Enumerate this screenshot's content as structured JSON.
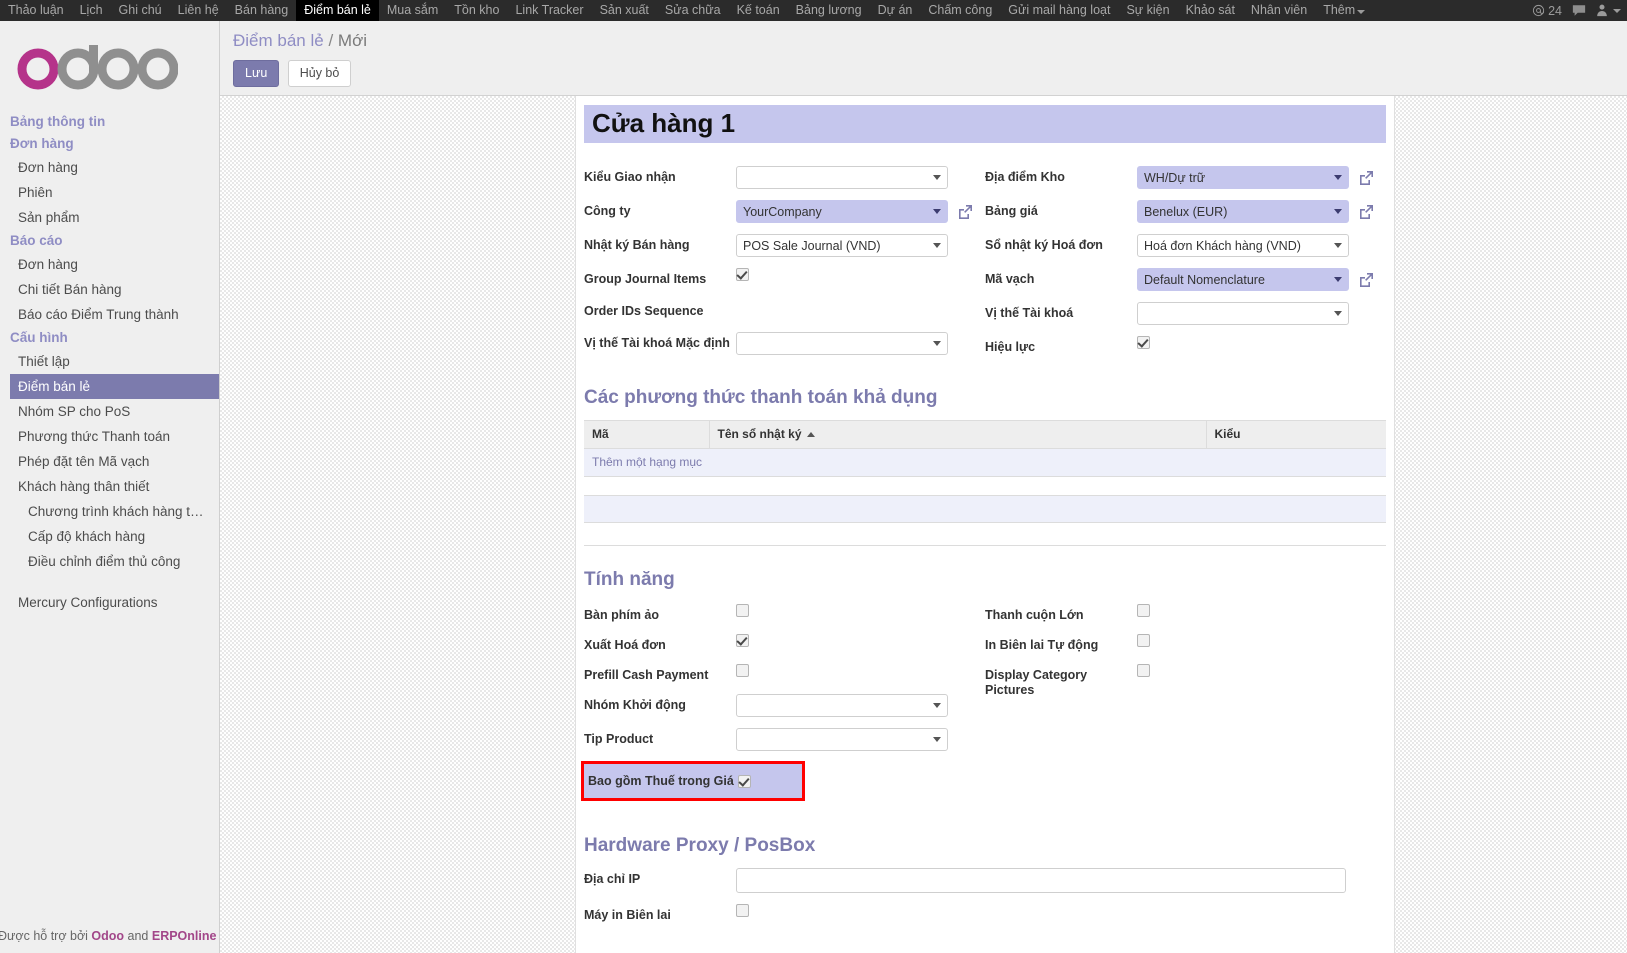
{
  "navbar": {
    "items": [
      {
        "label": "Thảo luận",
        "active": false
      },
      {
        "label": "Lịch",
        "active": false
      },
      {
        "label": "Ghi chú",
        "active": false
      },
      {
        "label": "Liên hệ",
        "active": false
      },
      {
        "label": "Bán hàng",
        "active": false
      },
      {
        "label": "Điểm bán lẻ",
        "active": true
      },
      {
        "label": "Mua sắm",
        "active": false
      },
      {
        "label": "Tồn kho",
        "active": false
      },
      {
        "label": "Link Tracker",
        "active": false
      },
      {
        "label": "Sản xuất",
        "active": false
      },
      {
        "label": "Sửa chữa",
        "active": false
      },
      {
        "label": "Kế toán",
        "active": false
      },
      {
        "label": "Bảng lương",
        "active": false
      },
      {
        "label": "Dự án",
        "active": false
      },
      {
        "label": "Chấm công",
        "active": false
      },
      {
        "label": "Gửi mail hàng loạt",
        "active": false
      },
      {
        "label": "Sự kiện",
        "active": false
      },
      {
        "label": "Khảo sát",
        "active": false
      },
      {
        "label": "Nhân viên",
        "active": false
      },
      {
        "label": "Thêm",
        "active": false,
        "caret": true
      }
    ],
    "mention_count": "24",
    "mention_icon": "at-sign-icon",
    "messages_icon": "chat-bubble-icon",
    "user_icon": "user-menu-icon"
  },
  "sidebar": {
    "logo_text": "odoo",
    "groups": [
      {
        "type": "section",
        "label": "Bảng thông tin"
      },
      {
        "type": "section",
        "label": "Đơn hàng"
      },
      {
        "type": "item",
        "label": "Đơn hàng"
      },
      {
        "type": "item",
        "label": "Phiên"
      },
      {
        "type": "item",
        "label": "Sản phẩm"
      },
      {
        "type": "section",
        "label": "Báo cáo"
      },
      {
        "type": "item",
        "label": "Đơn hàng"
      },
      {
        "type": "item",
        "label": "Chi tiết Bán hàng"
      },
      {
        "type": "item",
        "label": "Báo cáo Điểm Trung thành"
      },
      {
        "type": "section",
        "label": "Cấu hình"
      },
      {
        "type": "item",
        "label": "Thiết lập"
      },
      {
        "type": "item",
        "label": "Điểm bán lẻ",
        "selected": true
      },
      {
        "type": "item",
        "label": "Nhóm SP cho PoS"
      },
      {
        "type": "item",
        "label": "Phương thức Thanh toán"
      },
      {
        "type": "item",
        "label": "Phép đặt tên Mã vạch"
      },
      {
        "type": "item",
        "label": "Khách hàng thân thiết"
      },
      {
        "type": "item",
        "label": "Chương trình khách hàng t…",
        "indent": true
      },
      {
        "type": "item",
        "label": "Cấp độ khách hàng",
        "indent": true
      },
      {
        "type": "item",
        "label": "Điều chỉnh điểm thủ công",
        "indent": true
      },
      {
        "type": "item",
        "label": "Mercury Configurations",
        "standalone": true
      }
    ],
    "footer": {
      "prefix": "Được hỗ trợ bởi ",
      "link1": "Odoo",
      "middle": " and ",
      "link2": "ERPOnline"
    }
  },
  "control_panel": {
    "breadcrumb_root": "Điểm bán lẻ",
    "breadcrumb_sep": "/",
    "breadcrumb_current": "Mới",
    "save_label": "Lưu",
    "discard_label": "Hủy bỏ"
  },
  "form": {
    "record_title": "Cửa hàng 1",
    "left_fields": [
      {
        "label": "Kiểu Giao nhận",
        "type": "select",
        "value": "",
        "filled": false,
        "name": "picking-type-field"
      },
      {
        "label": "Công ty",
        "type": "select",
        "value": "YourCompany",
        "filled": true,
        "ext_link": true,
        "name": "company-field"
      },
      {
        "label": "Nhật ký Bán hàng",
        "type": "select",
        "value": "POS Sale Journal (VND)",
        "filled": false,
        "name": "sale-journal-field"
      },
      {
        "label": "Group Journal Items",
        "type": "checkbox",
        "checked": true,
        "name": "group-journal-items-checkbox"
      },
      {
        "label": "Order IDs Sequence",
        "type": "empty",
        "name": "order-ids-sequence-field"
      },
      {
        "label": "Vị thế Tài khoá Mặc định",
        "type": "select",
        "value": "",
        "filled": false,
        "name": "default-fiscal-position-field"
      }
    ],
    "right_fields": [
      {
        "label": "Địa điểm Kho",
        "type": "select",
        "value": "WH/Dự trữ",
        "filled": true,
        "ext_link": true,
        "name": "stock-location-field"
      },
      {
        "label": "Bảng giá",
        "type": "select",
        "value": "Benelux (EUR)",
        "filled": true,
        "ext_link": true,
        "name": "pricelist-field"
      },
      {
        "label": "Sổ nhật ký Hoá đơn",
        "type": "select",
        "value": "Hoá đơn Khách hàng (VND)",
        "filled": false,
        "name": "invoice-journal-field"
      },
      {
        "label": "Mã vạch",
        "type": "select",
        "value": "Default Nomenclature",
        "filled": true,
        "ext_link": true,
        "name": "barcode-nomenclature-field"
      },
      {
        "label": "Vị thế Tài khoá",
        "type": "select",
        "value": "",
        "filled": false,
        "name": "fiscal-position-field"
      },
      {
        "label": "Hiệu lực",
        "type": "checkbox",
        "checked": true,
        "name": "active-checkbox"
      }
    ]
  },
  "payment_section": {
    "title": "Các phương thức thanh toán khả dụng",
    "columns": [
      "Mã",
      "Tên sổ nhật ký",
      "Kiểu"
    ],
    "sorted_column_index": 1,
    "add_row_label": "Thêm một hạng mục"
  },
  "features_section": {
    "title": "Tính năng",
    "left_fields": [
      {
        "label": "Bàn phím ảo",
        "type": "checkbox",
        "checked": false,
        "name": "virtual-keyboard-checkbox"
      },
      {
        "label": "Xuất Hoá đơn",
        "type": "checkbox",
        "checked": true,
        "name": "invoicing-checkbox"
      },
      {
        "label": "Prefill Cash Payment",
        "type": "checkbox",
        "checked": false,
        "name": "prefill-cash-payment-checkbox"
      },
      {
        "label": "Nhóm Khởi động",
        "type": "select",
        "value": "",
        "filled": false,
        "name": "start-category-field"
      },
      {
        "label": "Tip Product",
        "type": "select",
        "value": "",
        "filled": false,
        "name": "tip-product-field"
      }
    ],
    "right_fields": [
      {
        "label": "Thanh cuộn Lớn",
        "type": "checkbox",
        "checked": false,
        "name": "large-scrollbars-checkbox"
      },
      {
        "label": "In Biên lai Tự động",
        "type": "checkbox",
        "checked": false,
        "name": "auto-print-receipt-checkbox"
      },
      {
        "label": "Display Category Pictures",
        "type": "checkbox",
        "checked": false,
        "name": "display-category-pictures-checkbox"
      }
    ],
    "highlighted_field": {
      "label": "Bao gồm Thuế trong Giá",
      "checked": true,
      "highlight_color": "#ff0000",
      "name": "tax-included-in-price-checkbox"
    }
  },
  "hardware_section": {
    "title": "Hardware Proxy / PosBox",
    "fields": [
      {
        "label": "Địa chỉ IP",
        "type": "text",
        "value": "",
        "name": "ip-address-input"
      },
      {
        "label": "Máy in Biên lai",
        "type": "checkbox",
        "checked": false,
        "name": "receipt-printer-checkbox"
      }
    ]
  },
  "colors": {
    "accent": "#7c7bad",
    "highlight_bg": "#c5c6ed",
    "navbar_bg": "#2b2b2b",
    "red_box": "#ff0000"
  }
}
